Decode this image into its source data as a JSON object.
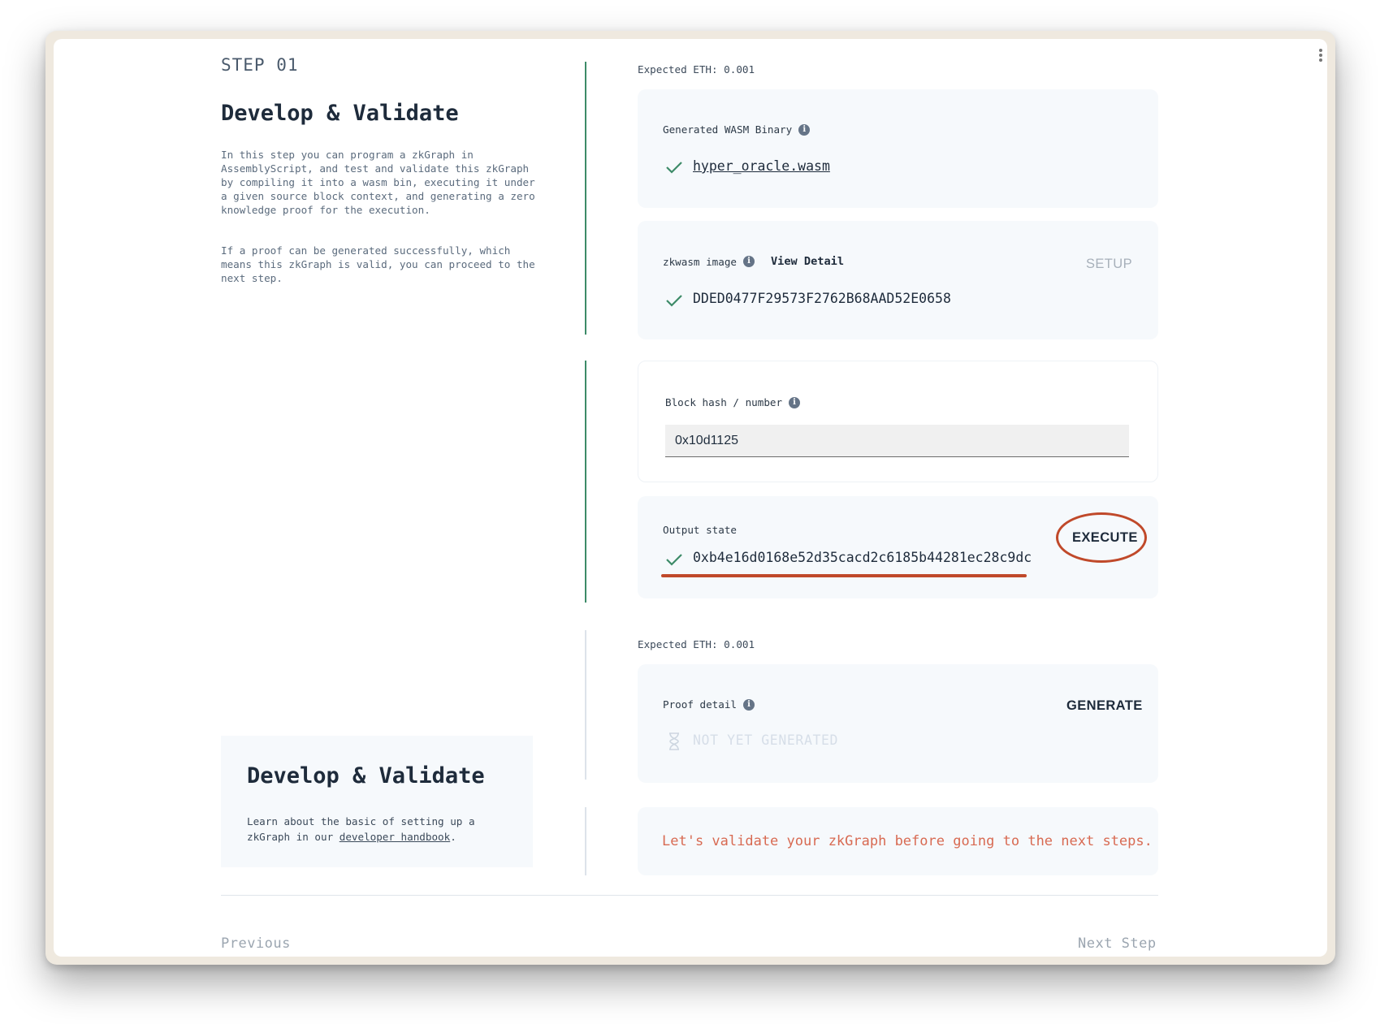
{
  "step": {
    "label": "STEP 01",
    "title": "Develop & Validate",
    "description_1": "In this step you can program a zkGraph in AssemblyScript, and test and validate this zkGraph by compiling it into a wasm bin, executing it under a given source block context, and generating a zero knowledge proof for the execution.",
    "description_2": "If a proof can be generated successfully, which means this zkGraph is valid, you can proceed to the next step."
  },
  "learn_card": {
    "title": "Develop & Validate",
    "text_before": "Learn about the basic of setting up a zkGraph in our ",
    "link": "developer handbook",
    "text_after": "."
  },
  "compile_section": {
    "expected_eth": "Expected ETH: 0.001",
    "wasm": {
      "label": "Generated WASM Binary",
      "value": "hyper_oracle.wasm",
      "status_icon": "check-icon"
    },
    "zkwasm": {
      "label": "zkwasm image",
      "view_detail": "View Detail",
      "action": "SETUP",
      "value": "DDED0477F29573F2762B68AAD52E0658",
      "status_icon": "check-icon"
    }
  },
  "execute_section": {
    "block": {
      "label": "Block hash / number",
      "value": "0x10d1125"
    },
    "output": {
      "label": "Output state",
      "action": "EXECUTE",
      "value": "0xb4e16d0168e52d35cacd2c6185b44281ec28c9dc",
      "status_icon": "check-icon"
    }
  },
  "proof_section": {
    "expected_eth": "Expected ETH: 0.001",
    "label": "Proof detail",
    "action": "GENERATE",
    "status": "NOT YET GENERATED",
    "status_icon": "hourglass-icon"
  },
  "warning": "Let's validate your zkGraph before going to the next steps.",
  "nav": {
    "previous": "Previous",
    "next": "Next Step"
  },
  "colors": {
    "accent_green": "#3d8b68",
    "annotation_red": "#c0492a",
    "warning_text": "#d86a52",
    "card_bg": "#f6f9fc"
  }
}
